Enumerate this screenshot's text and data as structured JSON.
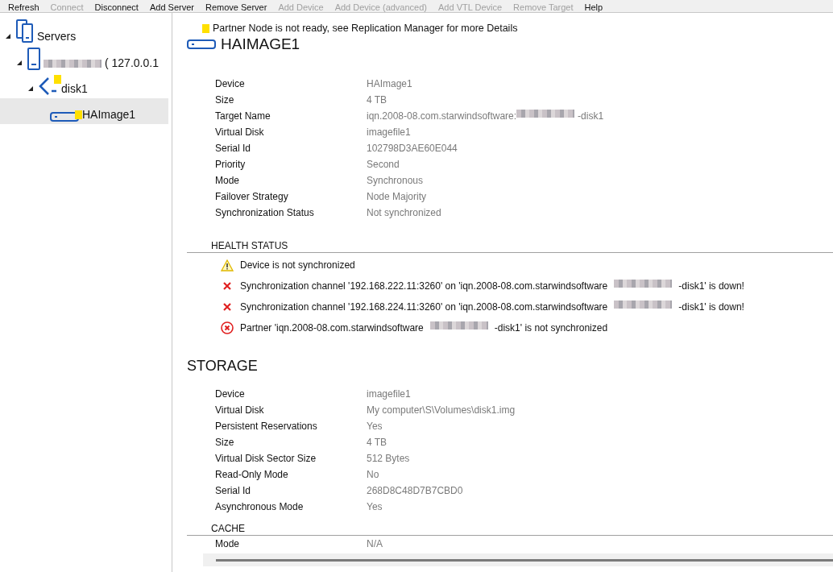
{
  "toolbar": [
    {
      "label": "Refresh",
      "disabled": false
    },
    {
      "label": "Connect",
      "disabled": true
    },
    {
      "label": "Disconnect",
      "disabled": false
    },
    {
      "label": "Add Server",
      "disabled": false
    },
    {
      "label": "Remove Server",
      "disabled": false
    },
    {
      "label": "Add Device",
      "disabled": true
    },
    {
      "label": "Add Device (advanced)",
      "disabled": true
    },
    {
      "label": "Add VTL Device",
      "disabled": true
    },
    {
      "label": "Remove Target",
      "disabled": true
    },
    {
      "label": "Help",
      "disabled": false
    }
  ],
  "tree": [
    {
      "kind": "servers",
      "label": "Servers",
      "expanded": true,
      "selected": false,
      "warning": false,
      "children": [
        {
          "kind": "server",
          "label": "( 127.0.0.1",
          "redacted": true,
          "expanded": true,
          "selected": false,
          "warning": false,
          "children": [
            {
              "kind": "target",
              "label": "disk1",
              "expanded": true,
              "selected": false,
              "warning": true,
              "children": [
                {
                  "kind": "device",
                  "label": "HAImage1",
                  "selected": true,
                  "warning": true
                }
              ]
            }
          ]
        }
      ]
    }
  ],
  "notice": "Partner Node is not ready, see Replication Manager for more Details",
  "title": "HAIMAGE1",
  "device_properties": [
    {
      "label": "Device",
      "value": "HAImage1"
    },
    {
      "label": "Size",
      "value": "4 TB"
    },
    {
      "label": "Target Name",
      "value": "iqn.2008-08.com.starwindsoftware:",
      "value_suffix": "-disk1"
    },
    {
      "label": "Virtual Disk",
      "value": "imagefile1"
    },
    {
      "label": "Serial Id",
      "value": "102798D3AE60E044"
    },
    {
      "label": "Priority",
      "value": "Second"
    },
    {
      "label": "Mode",
      "value": "Synchronous"
    },
    {
      "label": "Failover Strategy",
      "value": "Node Majority"
    },
    {
      "label": "Synchronization Status",
      "value": "Not synchronized"
    }
  ],
  "health_status": {
    "heading": "HEALTH STATUS",
    "items": [
      {
        "kind": "warning",
        "text": "Device is not synchronized"
      },
      {
        "kind": "error",
        "text": "Synchronization channel '192.168.222.11:3260' on 'iqn.2008-08.com.starwindsoftware",
        "text_suffix": "-disk1' is down!"
      },
      {
        "kind": "error",
        "text": "Synchronization channel '192.168.224.11:3260' on 'iqn.2008-08.com.starwindsoftware",
        "text_suffix": "-disk1' is down!"
      },
      {
        "kind": "critical",
        "text": "Partner 'iqn.2008-08.com.starwindsoftware",
        "text_suffix": "-disk1' is not synchronized"
      }
    ]
  },
  "storage": {
    "heading": "STORAGE",
    "properties": [
      {
        "label": "Device",
        "value": "imagefile1"
      },
      {
        "label": "Virtual Disk",
        "value": "My computer\\S\\Volumes\\disk1.img"
      },
      {
        "label": "Persistent Reservations",
        "value": "Yes"
      },
      {
        "label": "Size",
        "value": "4 TB"
      },
      {
        "label": "Virtual Disk Sector Size",
        "value": "512 Bytes"
      },
      {
        "label": "Read-Only Mode",
        "value": "No"
      },
      {
        "label": "Serial Id",
        "value": "268D8C48D7B7CBD0"
      },
      {
        "label": "Asynchronous Mode",
        "value": "Yes"
      }
    ]
  },
  "cache": {
    "heading": "CACHE",
    "properties": [
      {
        "label": "Mode",
        "value": "N/A"
      }
    ]
  }
}
